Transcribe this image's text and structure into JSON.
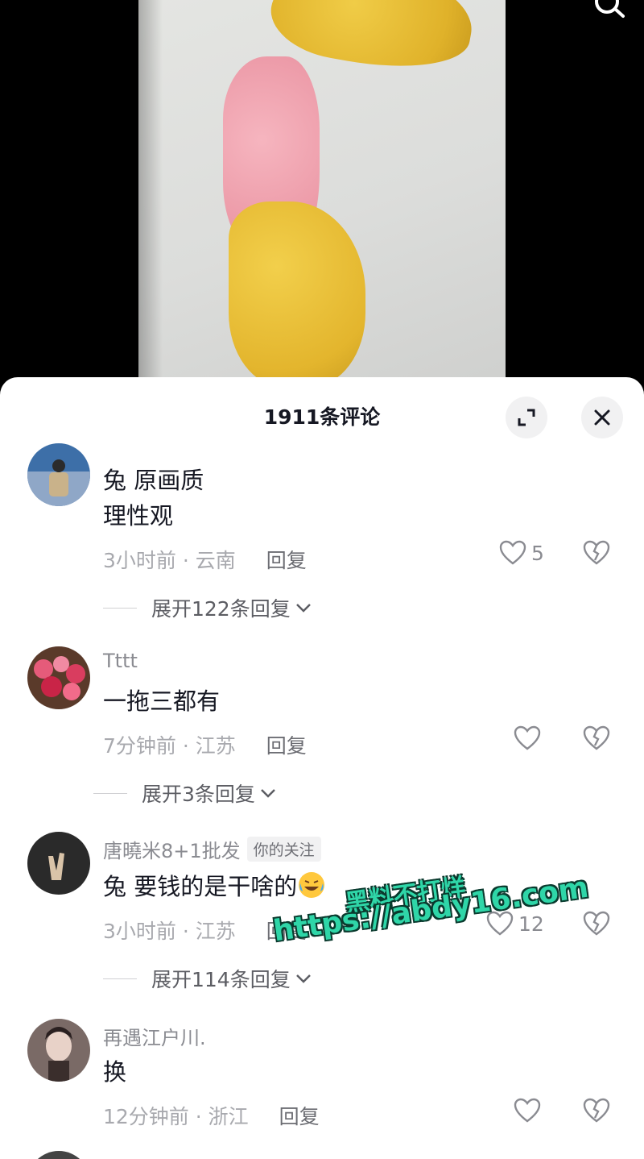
{
  "header": {
    "comment_count_title": "1911条评论"
  },
  "comments": [
    {
      "username": "",
      "text_lines": [
        "兔 原画质",
        "理性观"
      ],
      "time": "3小时前",
      "location": "云南",
      "reply_label": "回复",
      "likes": "5",
      "expand_label": "展开122条回复"
    },
    {
      "username": "Tttt",
      "text_lines": [
        "一拖三都有"
      ],
      "time": "7分钟前",
      "location": "江苏",
      "reply_label": "回复",
      "likes": "",
      "expand_label": "展开3条回复"
    },
    {
      "username": "唐曉米8+1批发",
      "tag": "你的关注",
      "text_lines": [
        "兔 要钱的是干啥的"
      ],
      "time": "3小时前",
      "location": "江苏",
      "reply_label": "回复",
      "likes": "12",
      "expand_label": "展开114条回复"
    },
    {
      "username": "再遇江户川.",
      "text_lines": [
        "换"
      ],
      "time": "12分钟前",
      "location": "浙江",
      "reply_label": "回复",
      "likes": ""
    }
  ],
  "watermark": {
    "line1": "黑料不打烊",
    "line2": "https://abdy16.com"
  },
  "icons": {
    "search": "search-icon",
    "expand": "expand-icon",
    "close": "close-icon",
    "like": "heart-outline-icon",
    "dislike": "broken-heart-icon",
    "chevron": "chevron-down-icon",
    "emoji": "crying-laughing-emoji-icon"
  },
  "colors": {
    "primary_text": "#161823",
    "secondary_text": "#8a8b91",
    "watermark": "#2fd6a8"
  }
}
